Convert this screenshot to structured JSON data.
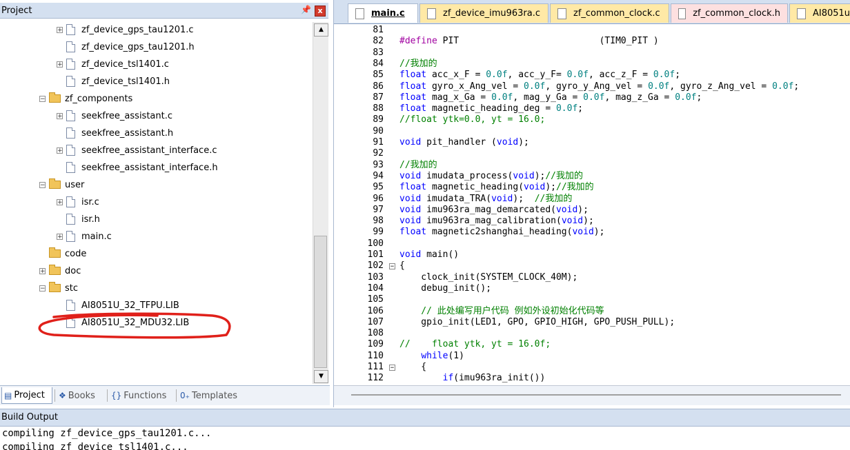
{
  "project_panel": {
    "title": "Project",
    "pin_glyph": "ᵩ",
    "close_glyph": "x",
    "tree": [
      {
        "label": "zf_device_gps_tau1201.c",
        "kind": "file",
        "expandable": true
      },
      {
        "label": "zf_device_gps_tau1201.h",
        "kind": "file",
        "expandable": false
      },
      {
        "label": "zf_device_tsl1401.c",
        "kind": "file",
        "expandable": true
      },
      {
        "label": "zf_device_tsl1401.h",
        "kind": "file",
        "expandable": false
      },
      {
        "label": "zf_components",
        "kind": "folder-open",
        "expandable": true
      },
      {
        "label": "seekfree_assistant.c",
        "kind": "file",
        "expandable": true
      },
      {
        "label": "seekfree_assistant.h",
        "kind": "file",
        "expandable": false
      },
      {
        "label": "seekfree_assistant_interface.c",
        "kind": "file",
        "expandable": true
      },
      {
        "label": "seekfree_assistant_interface.h",
        "kind": "file",
        "expandable": false
      },
      {
        "label": "user",
        "kind": "folder-open",
        "expandable": true
      },
      {
        "label": "isr.c",
        "kind": "file",
        "expandable": true
      },
      {
        "label": "isr.h",
        "kind": "file",
        "expandable": false
      },
      {
        "label": "main.c",
        "kind": "file",
        "expandable": true
      },
      {
        "label": "code",
        "kind": "folder",
        "expandable": false
      },
      {
        "label": "doc",
        "kind": "folder",
        "expandable": true
      },
      {
        "label": "stc",
        "kind": "folder-open",
        "expandable": true
      },
      {
        "label": "AI8051U_32_TFPU.LIB",
        "kind": "file",
        "expandable": false
      },
      {
        "label": "AI8051U_32_MDU32.LIB",
        "kind": "file",
        "expandable": false
      }
    ],
    "tabs": [
      {
        "label": "Project",
        "icon": "project-icon"
      },
      {
        "label": "Books",
        "icon": "books-icon"
      },
      {
        "label": "Functions",
        "icon": "functions-icon"
      },
      {
        "label": "Templates",
        "icon": "templates-icon"
      }
    ],
    "annotation_color": "#e0201a"
  },
  "editor": {
    "tabs": [
      {
        "label": "main.c",
        "active": true
      },
      {
        "label": "zf_device_imu963ra.c",
        "active": false
      },
      {
        "label": "zf_common_clock.c",
        "active": false
      },
      {
        "label": "zf_common_clock.h",
        "active": false
      },
      {
        "label": "AI8051u",
        "active": false
      }
    ],
    "lines": [
      {
        "n": "81",
        "segs": []
      },
      {
        "n": "82",
        "segs": [
          {
            "t": "#define",
            "c": "pp"
          },
          {
            "t": " PIT                          (TIM0_PIT )",
            "c": ""
          }
        ]
      },
      {
        "n": "83",
        "segs": []
      },
      {
        "n": "84",
        "segs": [
          {
            "t": "//我加的",
            "c": "cm"
          }
        ]
      },
      {
        "n": "85",
        "segs": [
          {
            "t": "float",
            "c": "kw"
          },
          {
            "t": " acc_x_F = ",
            "c": ""
          },
          {
            "t": "0.0f",
            "c": "nm"
          },
          {
            "t": ", acc_y_F= ",
            "c": ""
          },
          {
            "t": "0.0f",
            "c": "nm"
          },
          {
            "t": ", acc_z_F = ",
            "c": ""
          },
          {
            "t": "0.0f",
            "c": "nm"
          },
          {
            "t": ";",
            "c": ""
          }
        ]
      },
      {
        "n": "86",
        "segs": [
          {
            "t": "float",
            "c": "kw"
          },
          {
            "t": " gyro_x_Ang_vel = ",
            "c": ""
          },
          {
            "t": "0.0f",
            "c": "nm"
          },
          {
            "t": ", gyro_y_Ang_vel = ",
            "c": ""
          },
          {
            "t": "0.0f",
            "c": "nm"
          },
          {
            "t": ", gyro_z_Ang_vel = ",
            "c": ""
          },
          {
            "t": "0.0f",
            "c": "nm"
          },
          {
            "t": ";",
            "c": ""
          }
        ]
      },
      {
        "n": "87",
        "segs": [
          {
            "t": "float",
            "c": "kw"
          },
          {
            "t": " mag_x_Ga = ",
            "c": ""
          },
          {
            "t": "0.0f",
            "c": "nm"
          },
          {
            "t": ", mag_y_Ga = ",
            "c": ""
          },
          {
            "t": "0.0f",
            "c": "nm"
          },
          {
            "t": ", mag_z_Ga = ",
            "c": ""
          },
          {
            "t": "0.0f",
            "c": "nm"
          },
          {
            "t": ";",
            "c": ""
          }
        ]
      },
      {
        "n": "88",
        "segs": [
          {
            "t": "float",
            "c": "kw"
          },
          {
            "t": " magnetic_heading_deg = ",
            "c": ""
          },
          {
            "t": "0.0f",
            "c": "nm"
          },
          {
            "t": ";",
            "c": ""
          }
        ]
      },
      {
        "n": "89",
        "segs": [
          {
            "t": "//float ytk=0.0, yt = 16.0;",
            "c": "cm"
          }
        ]
      },
      {
        "n": "90",
        "segs": []
      },
      {
        "n": "91",
        "segs": [
          {
            "t": "void",
            "c": "kw"
          },
          {
            "t": " pit_handler (",
            "c": ""
          },
          {
            "t": "void",
            "c": "kw"
          },
          {
            "t": ");",
            "c": ""
          }
        ]
      },
      {
        "n": "92",
        "segs": []
      },
      {
        "n": "93",
        "segs": [
          {
            "t": "//我加的",
            "c": "cm"
          }
        ]
      },
      {
        "n": "94",
        "segs": [
          {
            "t": "void",
            "c": "kw"
          },
          {
            "t": " imudata_process(",
            "c": ""
          },
          {
            "t": "void",
            "c": "kw"
          },
          {
            "t": ");",
            "c": ""
          },
          {
            "t": "//我加的",
            "c": "cm"
          }
        ]
      },
      {
        "n": "95",
        "segs": [
          {
            "t": "float",
            "c": "kw"
          },
          {
            "t": " magnetic_heading(",
            "c": ""
          },
          {
            "t": "void",
            "c": "kw"
          },
          {
            "t": ");",
            "c": ""
          },
          {
            "t": "//我加的",
            "c": "cm"
          }
        ]
      },
      {
        "n": "96",
        "segs": [
          {
            "t": "void",
            "c": "kw"
          },
          {
            "t": " imudata_TRA(",
            "c": ""
          },
          {
            "t": "void",
            "c": "kw"
          },
          {
            "t": ");  ",
            "c": ""
          },
          {
            "t": "//我加的",
            "c": "cm"
          }
        ]
      },
      {
        "n": "97",
        "segs": [
          {
            "t": "void",
            "c": "kw"
          },
          {
            "t": " imu963ra_mag_demarcated(",
            "c": ""
          },
          {
            "t": "void",
            "c": "kw"
          },
          {
            "t": ");",
            "c": ""
          }
        ]
      },
      {
        "n": "98",
        "segs": [
          {
            "t": "void",
            "c": "kw"
          },
          {
            "t": " imu963ra_mag_calibration(",
            "c": ""
          },
          {
            "t": "void",
            "c": "kw"
          },
          {
            "t": ");",
            "c": ""
          }
        ]
      },
      {
        "n": "99",
        "segs": [
          {
            "t": "float",
            "c": "kw"
          },
          {
            "t": " magnetic2shanghai_heading(",
            "c": ""
          },
          {
            "t": "void",
            "c": "kw"
          },
          {
            "t": ");",
            "c": ""
          }
        ]
      },
      {
        "n": "100",
        "segs": []
      },
      {
        "n": "101",
        "segs": [
          {
            "t": "void",
            "c": "kw"
          },
          {
            "t": " main()",
            "c": ""
          }
        ]
      },
      {
        "n": "102",
        "fold": "-",
        "segs": [
          {
            "t": "{",
            "c": ""
          }
        ]
      },
      {
        "n": "103",
        "segs": [
          {
            "t": "    clock_init(SYSTEM_CLOCK_40M);",
            "c": ""
          }
        ]
      },
      {
        "n": "104",
        "segs": [
          {
            "t": "    debug_init();",
            "c": ""
          }
        ]
      },
      {
        "n": "105",
        "segs": []
      },
      {
        "n": "106",
        "segs": [
          {
            "t": "    // 此处编写用户代码 例如外设初始化代码等",
            "c": "cm"
          }
        ]
      },
      {
        "n": "107",
        "segs": [
          {
            "t": "    gpio_init(LED1, GPO, GPIO_HIGH, GPO_PUSH_PULL);",
            "c": ""
          }
        ]
      },
      {
        "n": "108",
        "segs": []
      },
      {
        "n": "109",
        "segs": [
          {
            "t": "//    float ytk, yt = 16.0f;",
            "c": "cm"
          }
        ]
      },
      {
        "n": "110",
        "segs": [
          {
            "t": "    ",
            "c": ""
          },
          {
            "t": "while",
            "c": "kw"
          },
          {
            "t": "(1)",
            "c": ""
          }
        ]
      },
      {
        "n": "111",
        "fold": "-",
        "segs": [
          {
            "t": "    {",
            "c": ""
          }
        ]
      },
      {
        "n": "112",
        "segs": [
          {
            "t": "        ",
            "c": ""
          },
          {
            "t": "if",
            "c": "kw"
          },
          {
            "t": "(imu963ra_init())",
            "c": ""
          }
        ]
      }
    ]
  },
  "build_output": {
    "title": "Build Output",
    "lines": [
      "compiling zf_device_gps_tau1201.c...",
      "compiling zf_device_tsl1401.c..."
    ]
  }
}
